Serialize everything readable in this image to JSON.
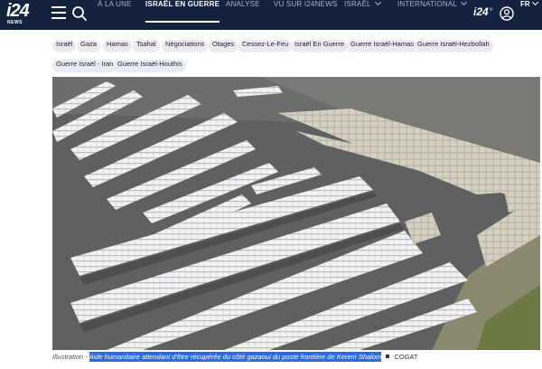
{
  "header": {
    "logo_text": "i24",
    "logo_sub": "NEWS",
    "nav": [
      {
        "label": "À LA UNE",
        "active": false,
        "dropdown": false
      },
      {
        "label": "ISRAËL EN GUERRE",
        "active": true,
        "dropdown": false
      },
      {
        "label": "ANALYSE",
        "active": false,
        "dropdown": false
      },
      {
        "label": "VU SUR I24NEWS",
        "active": false,
        "dropdown": false
      },
      {
        "label": "ISRAËL",
        "active": false,
        "dropdown": true
      },
      {
        "label": "INTERNATIONAL",
        "active": false,
        "dropdown": true
      }
    ],
    "plus_logo": "i24",
    "plus_symbol": "+",
    "language": "FR",
    "colors": {
      "bar": "#12223f",
      "accent": "#3aa0ff"
    }
  },
  "tags": [
    "Israël",
    "Gaza",
    "Hamas",
    "Tsahal",
    "Négociations",
    "Otages",
    "Cessez-Le-Feu",
    "Israël En Guerre",
    "Guerre Israël-Hamas",
    "Guerre Israël-Hezbollah",
    "Guerre Israël - Iran",
    "Guerre Israël-Houthis"
  ],
  "caption": {
    "label": "Illustration - ",
    "highlighted": "Aide humanitaire attendant d'être récupérée du côté gazaoui du poste frontière de Kerem Shalom",
    "credit": "COGAT"
  }
}
